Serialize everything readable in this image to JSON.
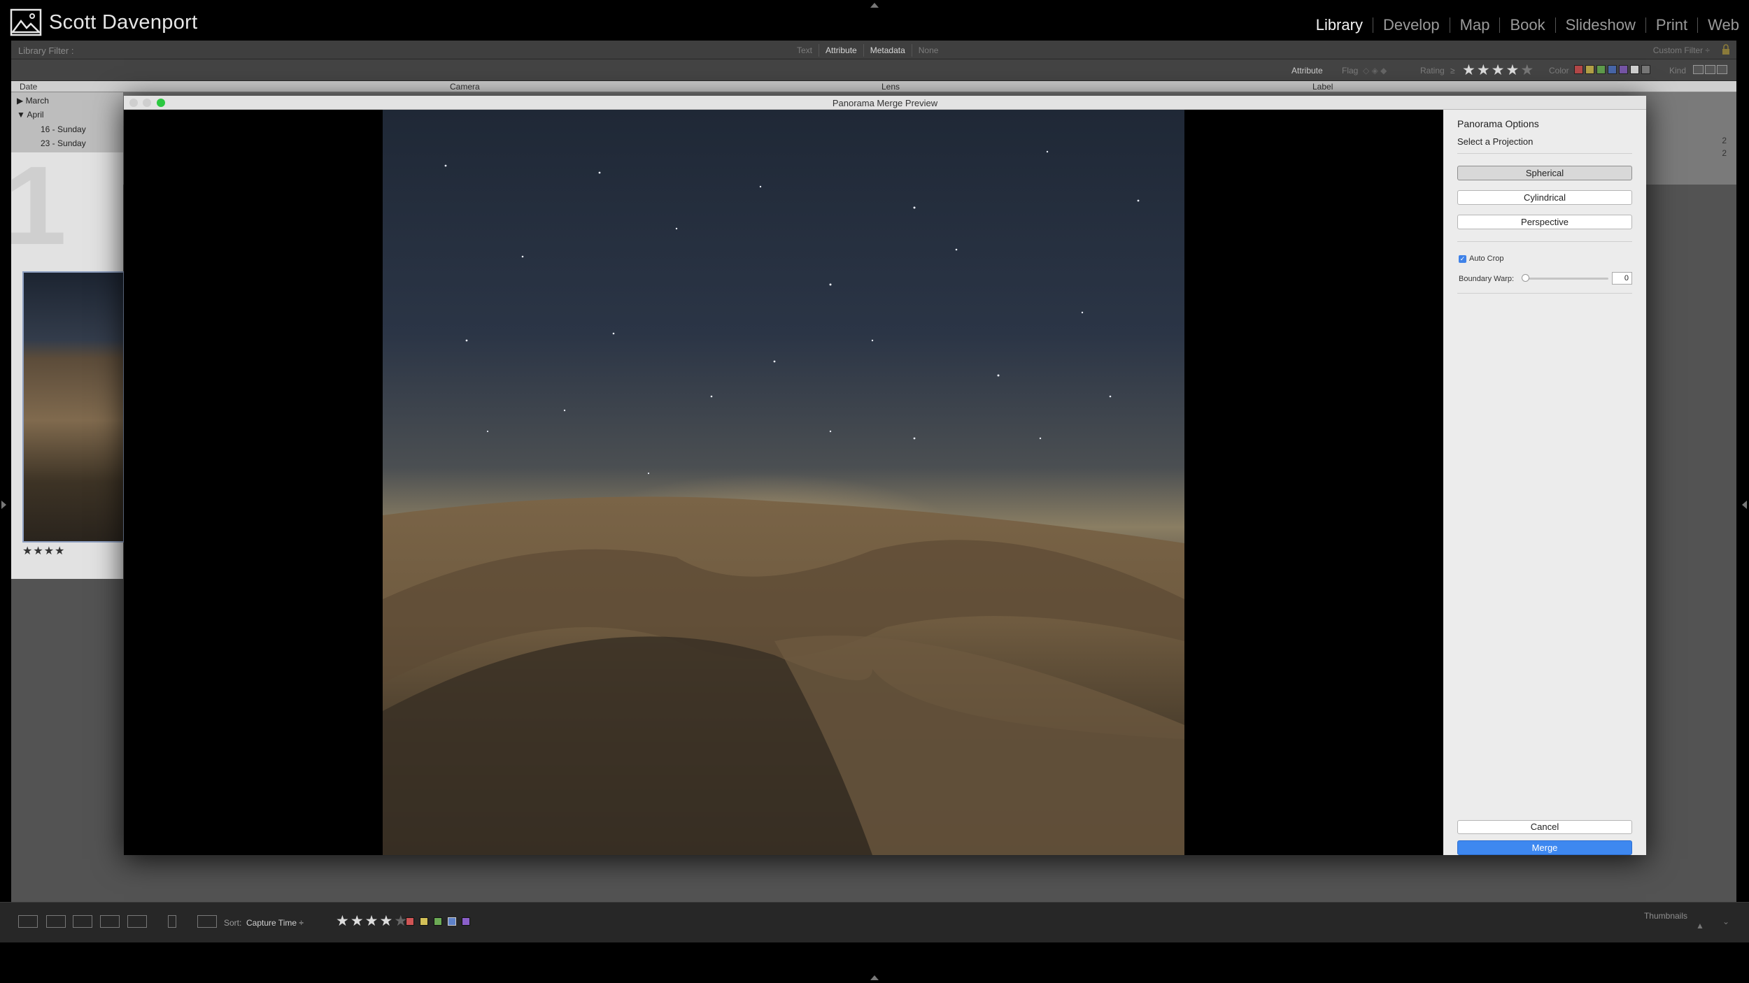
{
  "identity": {
    "name": "Scott Davenport"
  },
  "modules": [
    {
      "label": "Library",
      "active": true
    },
    {
      "label": "Develop"
    },
    {
      "label": "Map"
    },
    {
      "label": "Book"
    },
    {
      "label": "Slideshow"
    },
    {
      "label": "Print"
    },
    {
      "label": "Web"
    }
  ],
  "library_filter": {
    "title": "Library Filter :",
    "tabs": [
      "Text",
      "Attribute",
      "Metadata",
      "None"
    ],
    "active_tab": "Metadata",
    "custom_filter": "Custom Filter ÷"
  },
  "attribute_bar": {
    "attribute_label": "Attribute",
    "flag_label": "Flag",
    "rating_label": "Rating",
    "rating_op": "≥",
    "rating_stars": "★★★★",
    "rating_stars_dim": "★",
    "color_label": "Color",
    "kind_label": "Kind",
    "swatches": [
      "#b54848",
      "#b4a247",
      "#5f9c4c",
      "#4866a8",
      "#7655a6",
      "#cfcfcf",
      "#777777"
    ]
  },
  "metadata_browser": {
    "columns": [
      "Date",
      "Camera",
      "Lens",
      "Label"
    ],
    "rows": [
      "▶ March",
      "▼ April",
      "16 - Sunday",
      "23 - Sunday"
    ],
    "counts": [
      "2",
      "2"
    ]
  },
  "grid": {
    "big_number": "1",
    "thumb_stars": "★★★★"
  },
  "dialog": {
    "title": "Panorama Merge Preview",
    "options": {
      "heading": "Panorama Options",
      "subheading": "Select a Projection",
      "projections": [
        "Spherical",
        "Cylindrical",
        "Perspective"
      ],
      "selected_projection": "Spherical",
      "auto_crop_label": "Auto Crop",
      "auto_crop_checked": true,
      "boundary_warp_label": "Boundary Warp:",
      "boundary_warp_value": "0",
      "cancel_label": "Cancel",
      "merge_label": "Merge"
    }
  },
  "toolbar": {
    "sort_label": "Sort:",
    "sort_value": "Capture Time ÷",
    "stars": "★★★★",
    "stars_dim": "★",
    "swatches": [
      "#d05555",
      "#d3c058",
      "#6caa55",
      "#5f82c9",
      "#8a5fc9"
    ],
    "thumbnails_label": "Thumbnails"
  },
  "colors": {
    "accent": "#3e88f0",
    "panel_bg": "#ececec",
    "library_bg": "#535353"
  }
}
